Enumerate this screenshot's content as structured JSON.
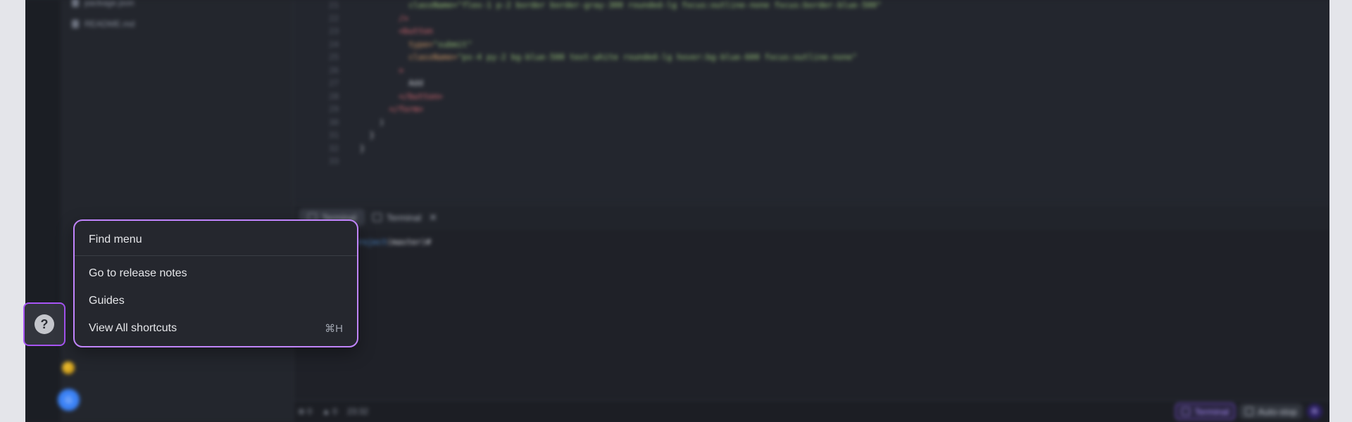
{
  "explorer": {
    "files": [
      {
        "name": "package.json"
      },
      {
        "name": "README.md"
      }
    ]
  },
  "editor": {
    "lines": [
      {
        "num": "21",
        "segments": [
          {
            "t": "          className=\"flex-1 p-2 border border-gray-300 rounded-lg focus:outline-none focus:border-blue-500\"",
            "c": "c-str"
          }
        ]
      },
      {
        "num": "22",
        "segments": [
          {
            "t": "        />",
            "c": "c-tag"
          }
        ]
      },
      {
        "num": "23",
        "segments": [
          {
            "t": "        <button",
            "c": "c-tag"
          }
        ]
      },
      {
        "num": "24",
        "segments": [
          {
            "t": "          type=",
            "c": "c-attr"
          },
          {
            "t": "\"submit\"",
            "c": "c-str"
          }
        ]
      },
      {
        "num": "25",
        "segments": [
          {
            "t": "          className=",
            "c": "c-attr"
          },
          {
            "t": "\"px-4 py-2 bg-blue-500 text-white rounded-lg hover:bg-blue-600 focus:outline-none\"",
            "c": "c-str"
          }
        ]
      },
      {
        "num": "26",
        "segments": [
          {
            "t": "        >",
            "c": "c-tag"
          }
        ]
      },
      {
        "num": "27",
        "segments": [
          {
            "t": "          Add",
            "c": "c-txt"
          }
        ]
      },
      {
        "num": "28",
        "segments": [
          {
            "t": "        </button>",
            "c": "c-tag"
          }
        ]
      },
      {
        "num": "29",
        "segments": [
          {
            "t": "      </form>",
            "c": "c-tag"
          }
        ]
      },
      {
        "num": "30",
        "segments": [
          {
            "t": "    )",
            "c": "c-txt"
          }
        ]
      },
      {
        "num": "31",
        "segments": [
          {
            "t": "  }",
            "c": "c-txt"
          }
        ]
      },
      {
        "num": "32",
        "segments": [
          {
            "t": "}",
            "c": "c-txt"
          }
        ]
      },
      {
        "num": "33",
        "segments": [
          {
            "t": "",
            "c": "c-txt"
          }
        ]
      }
    ]
  },
  "panel": {
    "tabs": [
      {
        "label": "Terminal"
      },
      {
        "label": "Terminal"
      }
    ],
    "terminal": {
      "path": "/workspace/project",
      "branch": "(master)#"
    }
  },
  "statusbar": {
    "errors": "0",
    "warnings": "0",
    "time": "23:32",
    "terminal_label": "Terminal",
    "autostop_label": "Auto-stop",
    "logo_text": "G"
  },
  "user": {
    "avatar_initial": "G"
  },
  "help_menu": {
    "items": [
      {
        "label": "Find menu",
        "shortcut": ""
      },
      {
        "label": "Go to release notes",
        "shortcut": ""
      },
      {
        "label": "Guides",
        "shortcut": ""
      },
      {
        "label": "View All shortcuts",
        "shortcut": "⌘H"
      }
    ]
  },
  "colors": {
    "highlight": "#a855f7",
    "background": "#20232a"
  }
}
